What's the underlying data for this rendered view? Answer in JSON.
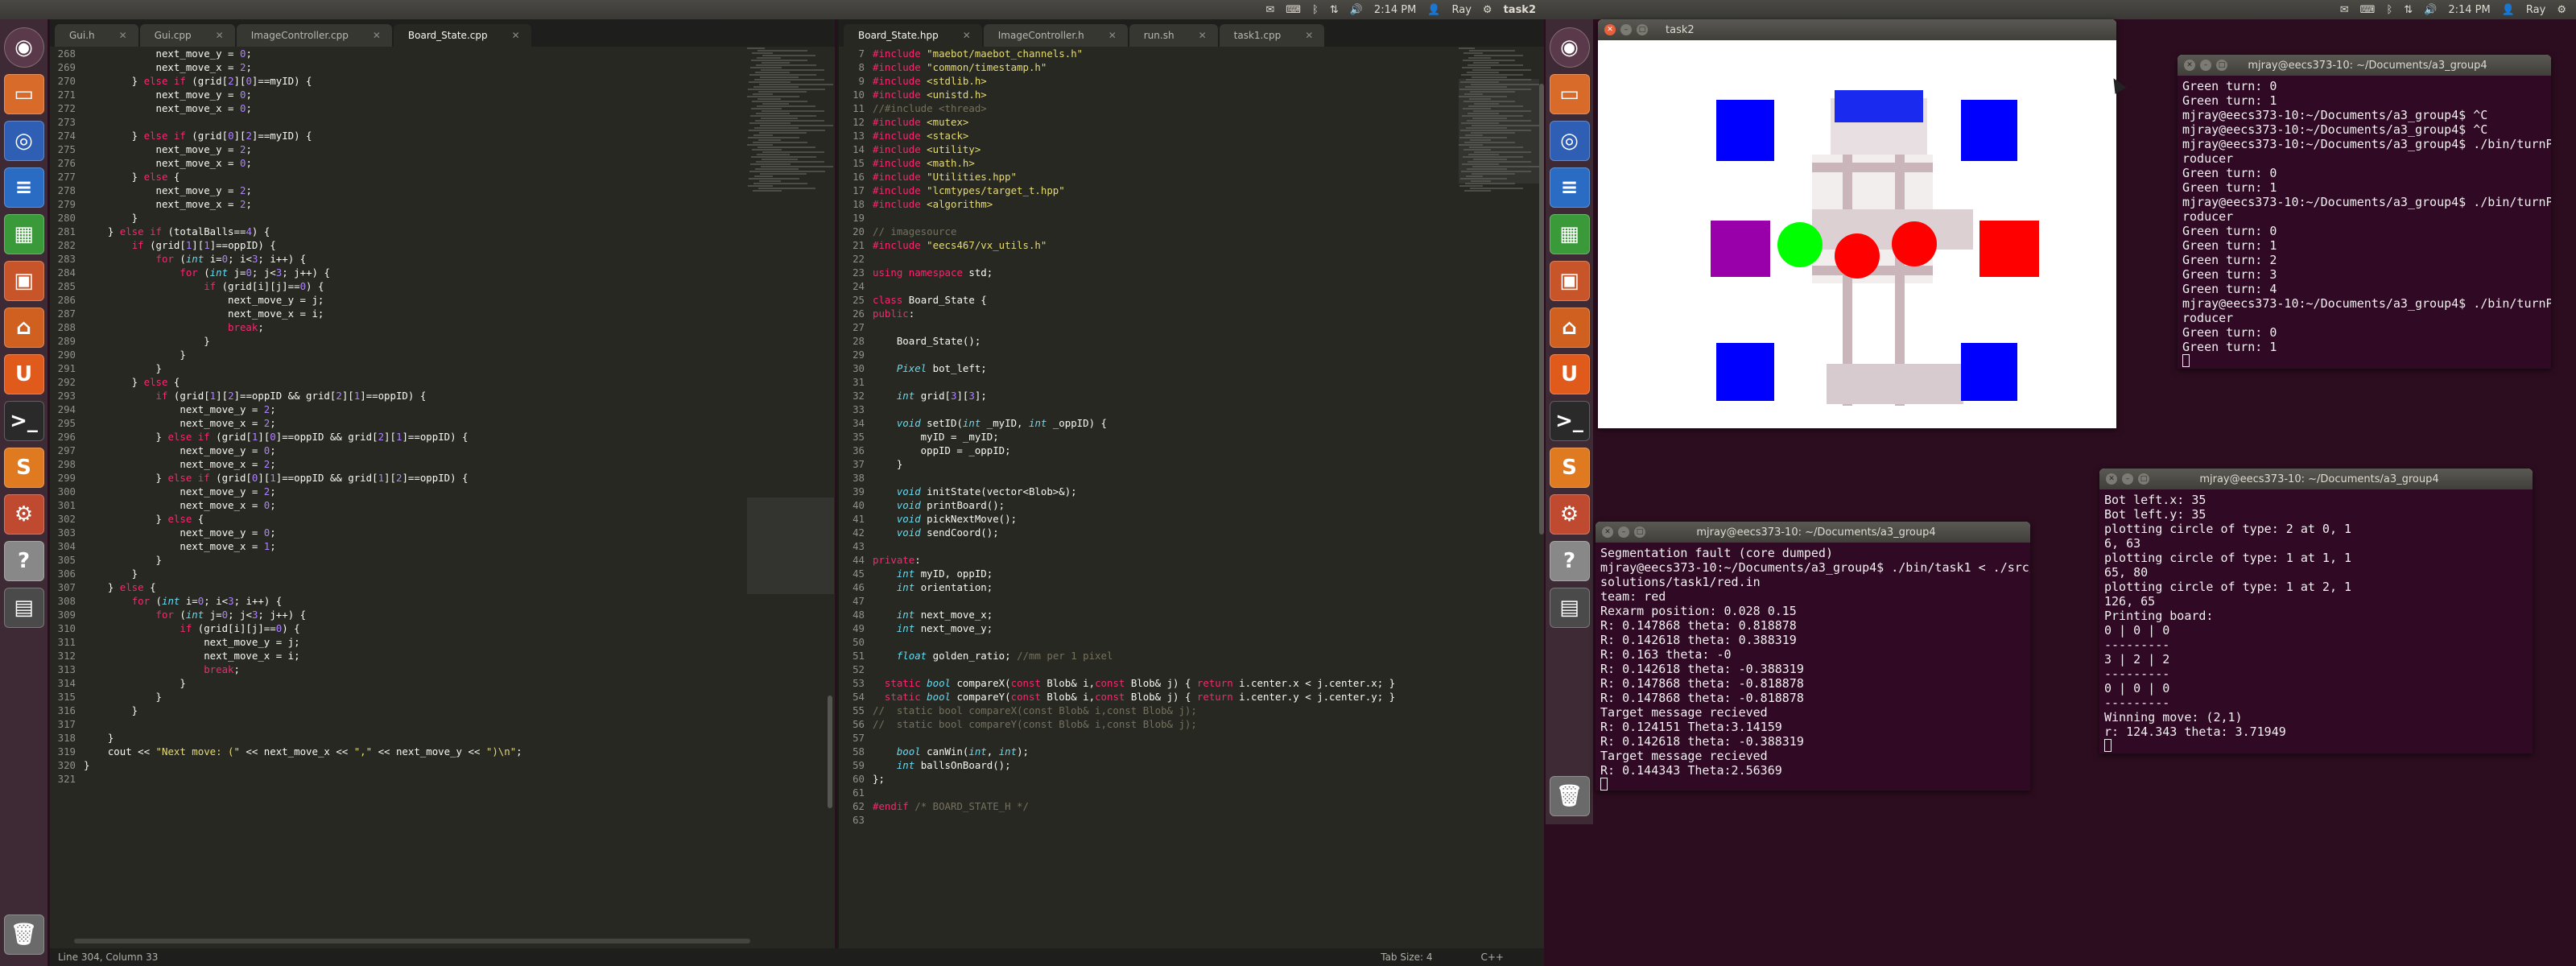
{
  "topbar": {
    "left_tray": [
      "2:14 PM",
      "Ray"
    ],
    "left_title": "task2",
    "right_tray": [
      "2:14 PM",
      "Ray"
    ]
  },
  "launcher_left": [
    "dash-home",
    "files",
    "firefox",
    "writer",
    "calc",
    "impress",
    "software-center",
    "ubuntu-one",
    "terminal",
    "sublime",
    "settings",
    "help",
    "workspaces"
  ],
  "launcher_right": [
    "dash-home",
    "files",
    "firefox",
    "writer",
    "calc",
    "impress",
    "software-center",
    "ubuntu-one",
    "terminal",
    "sublime",
    "settings",
    "help",
    "workspaces"
  ],
  "launcher_labels": {
    "ubuntu_one": "U",
    "sublime": "S",
    "help": "?"
  },
  "editor": {
    "left_tabs": [
      "Gui.h",
      "Gui.cpp",
      "ImageController.cpp",
      "Board_State.cpp"
    ],
    "right_tabs": [
      "Board_State.hpp",
      "ImageController.h",
      "run.sh",
      "task1.cpp"
    ],
    "status_left": "Line 304, Column 33",
    "status_tab": "Tab Size: 4",
    "status_lang": "C++",
    "left_lines": [
      [
        "268",
        "            next_move_y = 0;"
      ],
      [
        "269",
        "            next_move_x = 2;"
      ],
      [
        "270",
        "        } else if (grid[2][0]==myID) {"
      ],
      [
        "271",
        "            next_move_y = 0;"
      ],
      [
        "272",
        "            next_move_x = 0;"
      ],
      [
        "273",
        ""
      ],
      [
        "274",
        "        } else if (grid[0][2]==myID) {"
      ],
      [
        "275",
        "            next_move_y = 2;"
      ],
      [
        "276",
        "            next_move_x = 0;"
      ],
      [
        "277",
        "        } else {"
      ],
      [
        "278",
        "            next_move_y = 2;"
      ],
      [
        "279",
        "            next_move_x = 2;"
      ],
      [
        "280",
        "        }"
      ],
      [
        "281",
        "    } else if (totalBalls==4) {"
      ],
      [
        "282",
        "        if (grid[1][1]==oppID) {"
      ],
      [
        "283",
        "            for (int i=0; i<3; i++) {"
      ],
      [
        "284",
        "                for (int j=0; j<3; j++) {"
      ],
      [
        "285",
        "                    if (grid[i][j]==0) {"
      ],
      [
        "286",
        "                        next_move_y = j;"
      ],
      [
        "287",
        "                        next_move_x = i;"
      ],
      [
        "288",
        "                        break;"
      ],
      [
        "289",
        "                    }"
      ],
      [
        "290",
        "                }"
      ],
      [
        "291",
        "            }"
      ],
      [
        "292",
        "        } else {"
      ],
      [
        "293",
        "            if (grid[1][2]==oppID && grid[2][1]==oppID) {"
      ],
      [
        "294",
        "                next_move_y = 2;"
      ],
      [
        "295",
        "                next_move_x = 2;"
      ],
      [
        "296",
        "            } else if (grid[1][0]==oppID && grid[2][1]==oppID) {"
      ],
      [
        "297",
        "                next_move_y = 0;"
      ],
      [
        "298",
        "                next_move_x = 2;"
      ],
      [
        "299",
        "            } else if (grid[0][1]==oppID && grid[1][2]==oppID) {"
      ],
      [
        "300",
        "                next_move_y = 2;"
      ],
      [
        "301",
        "                next_move_x = 0;"
      ],
      [
        "302",
        "            } else {"
      ],
      [
        "303",
        "                next_move_y = 0;"
      ],
      [
        "304",
        "                next_move_x = 1;"
      ],
      [
        "305",
        "            }"
      ],
      [
        "306",
        "        }"
      ],
      [
        "307",
        "    } else {"
      ],
      [
        "308",
        "        for (int i=0; i<3; i++) {"
      ],
      [
        "309",
        "            for (int j=0; j<3; j++) {"
      ],
      [
        "310",
        "                if (grid[i][j]==0) {"
      ],
      [
        "311",
        "                    next_move_y = j;"
      ],
      [
        "312",
        "                    next_move_x = i;"
      ],
      [
        "313",
        "                    break;"
      ],
      [
        "314",
        "                }"
      ],
      [
        "315",
        "            }"
      ],
      [
        "316",
        "        }"
      ],
      [
        "317",
        ""
      ],
      [
        "318",
        "    }"
      ],
      [
        "319",
        "    cout << \"Next move: (\" << next_move_x << \",\" << next_move_y << \")\\n\";"
      ],
      [
        "320",
        "}"
      ],
      [
        "321",
        ""
      ]
    ],
    "right_lines": [
      [
        "7",
        "#include \"maebot/maebot_channels.h\""
      ],
      [
        "8",
        "#include \"common/timestamp.h\""
      ],
      [
        "9",
        "#include <stdlib.h>"
      ],
      [
        "10",
        "#include <unistd.h>"
      ],
      [
        "11",
        "//#include <thread>"
      ],
      [
        "12",
        "#include <mutex>"
      ],
      [
        "13",
        "#include <stack>"
      ],
      [
        "14",
        "#include <utility>"
      ],
      [
        "15",
        "#include <math.h>"
      ],
      [
        "16",
        "#include \"Utilities.hpp\""
      ],
      [
        "17",
        "#include \"lcmtypes/target_t.hpp\""
      ],
      [
        "18",
        "#include <algorithm>"
      ],
      [
        "19",
        ""
      ],
      [
        "20",
        "// imagesource"
      ],
      [
        "21",
        "#include \"eecs467/vx_utils.h\""
      ],
      [
        "22",
        ""
      ],
      [
        "23",
        "using namespace std;"
      ],
      [
        "24",
        ""
      ],
      [
        "25",
        "class Board_State {"
      ],
      [
        "26",
        "public:"
      ],
      [
        "27",
        ""
      ],
      [
        "28",
        "    Board_State();"
      ],
      [
        "29",
        ""
      ],
      [
        "30",
        "    Pixel bot_left;"
      ],
      [
        "31",
        ""
      ],
      [
        "32",
        "    int grid[3][3];"
      ],
      [
        "33",
        ""
      ],
      [
        "34",
        "    void setID(int _myID, int _oppID) {"
      ],
      [
        "35",
        "        myID = _myID;"
      ],
      [
        "36",
        "        oppID = _oppID;"
      ],
      [
        "37",
        "    }"
      ],
      [
        "38",
        ""
      ],
      [
        "39",
        "    void initState(vector<Blob>&);"
      ],
      [
        "40",
        "    void printBoard();"
      ],
      [
        "41",
        "    void pickNextMove();"
      ],
      [
        "42",
        "    void sendCoord();"
      ],
      [
        "43",
        ""
      ],
      [
        "44",
        "private:"
      ],
      [
        "45",
        "    int myID, oppID;"
      ],
      [
        "46",
        "    int orientation;"
      ],
      [
        "47",
        ""
      ],
      [
        "48",
        "    int next_move_x;"
      ],
      [
        "49",
        "    int next_move_y;"
      ],
      [
        "50",
        ""
      ],
      [
        "51",
        "    float golden_ratio; //mm per 1 pixel"
      ],
      [
        "52",
        ""
      ],
      [
        "53",
        "  static bool compareX(const Blob& i,const Blob& j) { return i.center.x < j.center.x; }"
      ],
      [
        "54",
        "  static bool compareY(const Blob& i,const Blob& j) { return i.center.y < j.center.y; }"
      ],
      [
        "55",
        "//  static bool compareX(const Blob& i,const Blob& j);"
      ],
      [
        "56",
        "//  static bool compareY(const Blob& i,const Blob& j);"
      ],
      [
        "57",
        ""
      ],
      [
        "58",
        "    bool canWin(int, int);"
      ],
      [
        "59",
        "    int ballsOnBoard();"
      ],
      [
        "60",
        "};"
      ],
      [
        "61",
        ""
      ],
      [
        "62",
        "#endif /* BOARD_STATE_H */"
      ],
      [
        "63",
        ""
      ]
    ]
  },
  "task2_window": {
    "title": "task2"
  },
  "terminal_top": {
    "title": "mjray@eecs373-10: ~/Documents/a3_group4",
    "lines": [
      "Green turn: 0",
      "Green turn: 1",
      "mjray@eecs373-10:~/Documents/a3_group4$ ^C",
      "mjray@eecs373-10:~/Documents/a3_group4$ ^C",
      "mjray@eecs373-10:~/Documents/a3_group4$ ./bin/turnP",
      "roducer",
      "Green turn: 0",
      "Green turn: 1",
      "mjray@eecs373-10:~/Documents/a3_group4$ ./bin/turnP",
      "roducer",
      "Green turn: 0",
      "Green turn: 1",
      "Green turn: 2",
      "Green turn: 3",
      "Green turn: 4",
      "mjray@eecs373-10:~/Documents/a3_group4$ ./bin/turnP",
      "roducer",
      "Green turn: 0",
      "Green turn: 1"
    ]
  },
  "terminal_mid": {
    "title": "mjray@eecs373-10: ~/Documents/a3_group4",
    "lines": [
      "Segmentation fault (core dumped)",
      "mjray@eecs373-10:~/Documents/a3_group4$ ./bin/task1 < ./src/",
      "solutions/task1/red.in",
      "team: red",
      "Rexarm position: 0.028 0.15",
      "R: 0.147868 theta: 0.818878",
      "R: 0.142618 theta: 0.388319",
      "R: 0.163 theta: -0",
      "R: 0.142618 theta: -0.388319",
      "R: 0.147868 theta: -0.818878",
      "R: 0.147868 theta: -0.818878",
      "Target message recieved",
      "R: 0.124151 Theta:3.14159",
      "R: 0.142618 theta: -0.388319",
      "Target message recieved",
      "R: 0.144343 Theta:2.56369"
    ]
  },
  "terminal_right": {
    "title": "mjray@eecs373-10: ~/Documents/a3_group4",
    "lines": [
      "Bot left.x: 35",
      "Bot left.y: 35",
      "plotting circle of type: 2 at 0, 1",
      "6, 63",
      "plotting circle of type: 1 at 1, 1",
      "65, 80",
      "plotting circle of type: 1 at 2, 1",
      "126, 65",
      "Printing board:",
      "0 | 0 | 0",
      "---------",
      "3 | 2 | 2",
      "---------",
      "0 | 0 | 0",
      "---------",
      "Winning move: (2,1)",
      "r: 124.343 theta: 3.71949"
    ]
  },
  "colors": {
    "desktop": "#2c0d1f",
    "editor_bg": "#272822",
    "terminal_bg": "#300a24",
    "blue": "#0000ff",
    "red": "#ff0000",
    "green": "#00ff00",
    "purple": "#9900aa"
  }
}
